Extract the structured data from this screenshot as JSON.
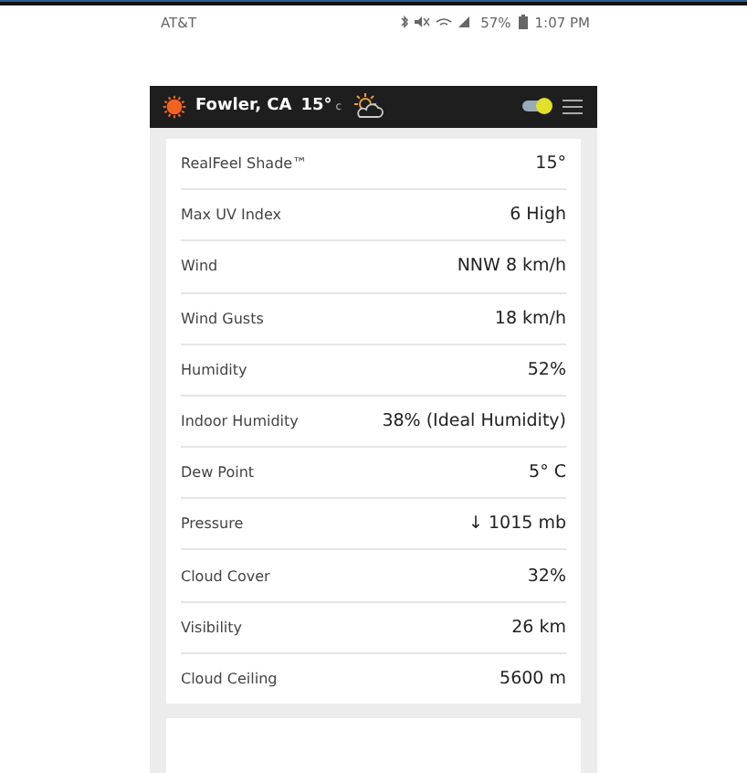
{
  "status_bar": {
    "carrier": "AT&T",
    "battery": "57%",
    "time": "1:07 PM"
  },
  "header": {
    "location": "Fowler, CA",
    "temperature": "15°",
    "unit": "c"
  },
  "details": [
    {
      "label": "RealFeel Shade™",
      "value": "15°"
    },
    {
      "label": "Max UV Index",
      "value": "6 High"
    },
    {
      "label": "Wind",
      "value": "NNW 8 km/h"
    },
    {
      "label": "Wind Gusts",
      "value": "18 km/h"
    },
    {
      "label": "Humidity",
      "value": "52%"
    },
    {
      "label": "Indoor Humidity",
      "value": "38% (Ideal Humidity)"
    },
    {
      "label": "Dew Point",
      "value": "5° C"
    },
    {
      "label": "Pressure",
      "value": "↓ 1015 mb"
    },
    {
      "label": "Cloud Cover",
      "value": "32%"
    },
    {
      "label": "Visibility",
      "value": "26 km"
    },
    {
      "label": "Cloud Ceiling",
      "value": "5600 m"
    }
  ]
}
